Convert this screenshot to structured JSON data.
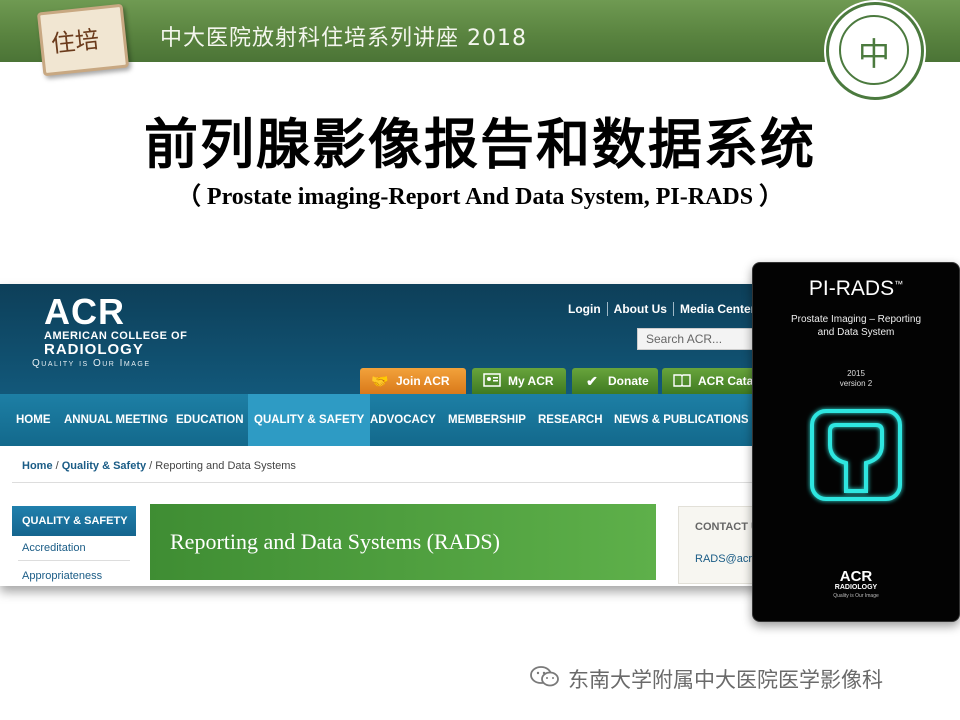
{
  "banner": {
    "title": "中大医院放射科住培系列讲座 2018",
    "tag_text": "住培",
    "seal_char": "中",
    "colors": {
      "banner": "#5a8440",
      "seal": "#4b7a3e"
    }
  },
  "slide": {
    "title": "前列腺影像报告和数据系统",
    "subtitle": "（ Prostate imaging-Report And Data System, PI-RADS ）"
  },
  "acr_site": {
    "logo": {
      "acronym": "ACR",
      "line1": "AMERICAN COLLEGE OF",
      "line2": "RADIOLOGY",
      "tagline": "Quality is Our Image"
    },
    "top_links": [
      "Login",
      "About Us",
      "Media Center"
    ],
    "search_placeholder": "Search ACR...",
    "header_buttons": [
      {
        "label": "Join ACR",
        "icon": "handshake-icon"
      },
      {
        "label": "My ACR",
        "icon": "id-card-icon"
      },
      {
        "label": "Donate",
        "icon": "checkmark-icon"
      },
      {
        "label": "ACR Cata",
        "icon": "book-icon"
      }
    ],
    "nav": [
      "HOME",
      "ANNUAL MEETING",
      "EDUCATION",
      "QUALITY & SAFETY",
      "ADVOCACY",
      "MEMBERSHIP",
      "RESEARCH",
      "NEWS & PUBLICATIONS"
    ],
    "nav_active": "QUALITY & SAFETY",
    "breadcrumb": {
      "home": "Home",
      "section": "Quality & Safety",
      "current": "Reporting and Data Systems",
      "sep": "/"
    },
    "sidebar": {
      "heading": "QUALITY & SAFETY",
      "items": [
        "Accreditation",
        "Appropriateness"
      ]
    },
    "banner_title": "Reporting and Data Systems (RADS)",
    "contact": {
      "label": "CONTACT U",
      "email": "RADS@acr"
    }
  },
  "card": {
    "title": "PI-RADS",
    "trademark": "™",
    "subtitle_line1": "Prostate Imaging – Reporting",
    "subtitle_line2": "and Data System",
    "year": "2015",
    "version": "version 2",
    "logo_acronym": "ACR",
    "logo_name": "RADIOLOGY",
    "logo_tagline": "Quality is Our Image",
    "icon": "prostate-outline-icon",
    "glow_color": "#2ee6e0"
  },
  "watermark": {
    "text": "东南大学附属中大医院医学影像科",
    "icon": "wechat-icon"
  }
}
